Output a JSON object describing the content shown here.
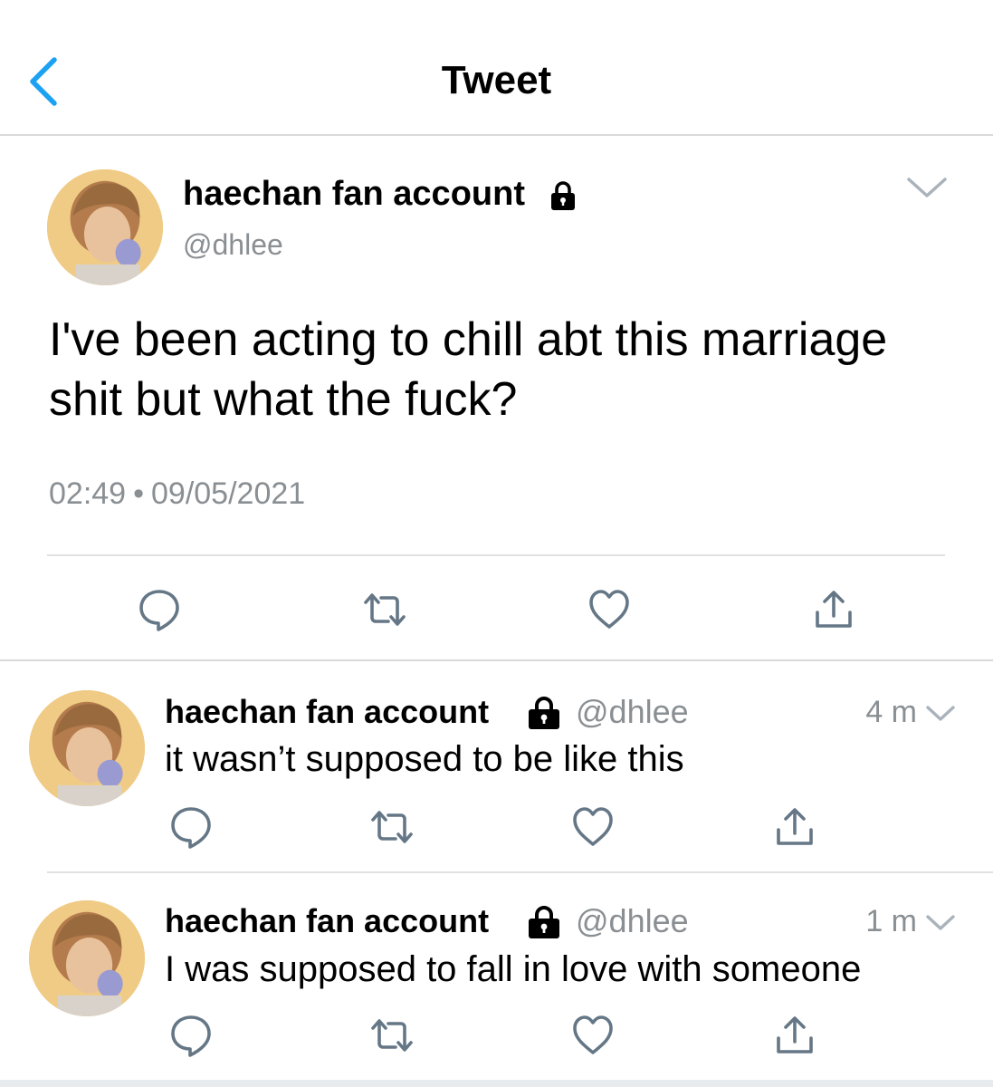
{
  "header": {
    "title": "Tweet",
    "back_icon": "chevron-left-icon"
  },
  "main_tweet": {
    "display_name": "haechan fan account",
    "handle": "@dhlee",
    "protected_icon": "lock-icon",
    "text": "I've been acting to chill abt this marriage shit but what the fuck?",
    "time": "02:49",
    "separator": "•",
    "date": "09/05/2021",
    "menu_icon": "chevron-down-icon"
  },
  "actions": [
    "reply-icon",
    "retweet-icon",
    "like-icon",
    "share-icon"
  ],
  "replies": [
    {
      "display_name": "haechan fan account",
      "handle": "@dhlee",
      "time": "4 m",
      "text": "it wasn’t supposed to be like this"
    },
    {
      "display_name": "haechan fan account",
      "handle": "@dhlee",
      "time": "1 m",
      "text": "I was supposed to fall in love with someone"
    }
  ],
  "colors": {
    "accent": "#1da1f2",
    "secondary_text": "#8a8f93",
    "icon": "#657786",
    "divider": "#e1e1e1"
  }
}
